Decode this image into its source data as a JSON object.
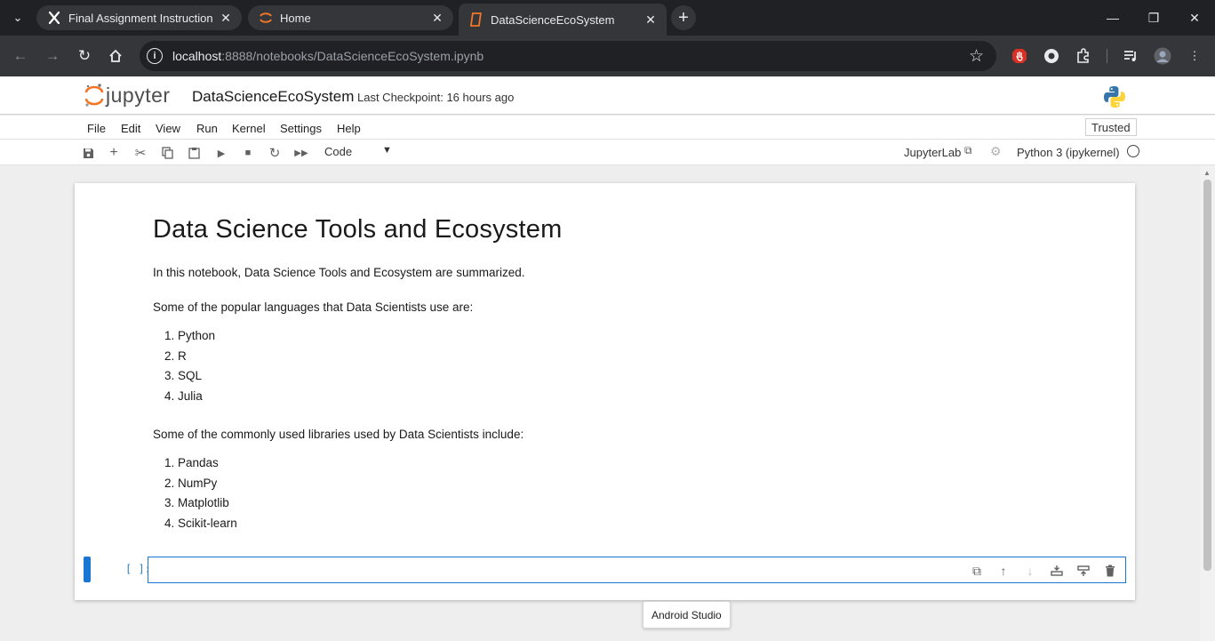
{
  "browser": {
    "tabs": [
      {
        "title": "Final Assignment Instructions: C",
        "favicon": "x-logo-icon",
        "active": false
      },
      {
        "title": "Home",
        "favicon": "jupyter-icon",
        "active": false
      },
      {
        "title": "DataScienceEcoSystem",
        "favicon": "notebook-icon",
        "active": true
      }
    ],
    "address": {
      "host": "localhost",
      "path": ":8888/notebooks/DataScienceEcoSystem.ipynb"
    }
  },
  "header": {
    "logo_text": "jupyter",
    "notebook_title": "DataScienceEcoSystem",
    "checkpoint": "Last Checkpoint: 16 hours ago"
  },
  "menubar": {
    "items": [
      "File",
      "Edit",
      "View",
      "Run",
      "Kernel",
      "Settings",
      "Help"
    ],
    "trusted": "Trusted"
  },
  "toolbar": {
    "cell_type": "Code",
    "jupyterlab_link": "JupyterLab",
    "kernel_name": "Python 3 (ipykernel)"
  },
  "notebook": {
    "heading": "Data Science Tools and Ecosystem",
    "intro": "In this notebook, Data Science Tools and Ecosystem are summarized.",
    "languages_intro": "Some of the popular languages that Data Scientists use are:",
    "languages": [
      "Python",
      "R",
      "SQL",
      "Julia"
    ],
    "libraries_intro": "Some of the commonly used libraries used by Data Scientists include:",
    "libraries": [
      "Pandas",
      "NumPy",
      "Matplotlib",
      "Scikit-learn"
    ],
    "code_prompt": "[ ]:"
  },
  "tooltip": "Android Studio",
  "colors": {
    "accent": "#1976d2",
    "jupyter_orange": "#f37726"
  }
}
